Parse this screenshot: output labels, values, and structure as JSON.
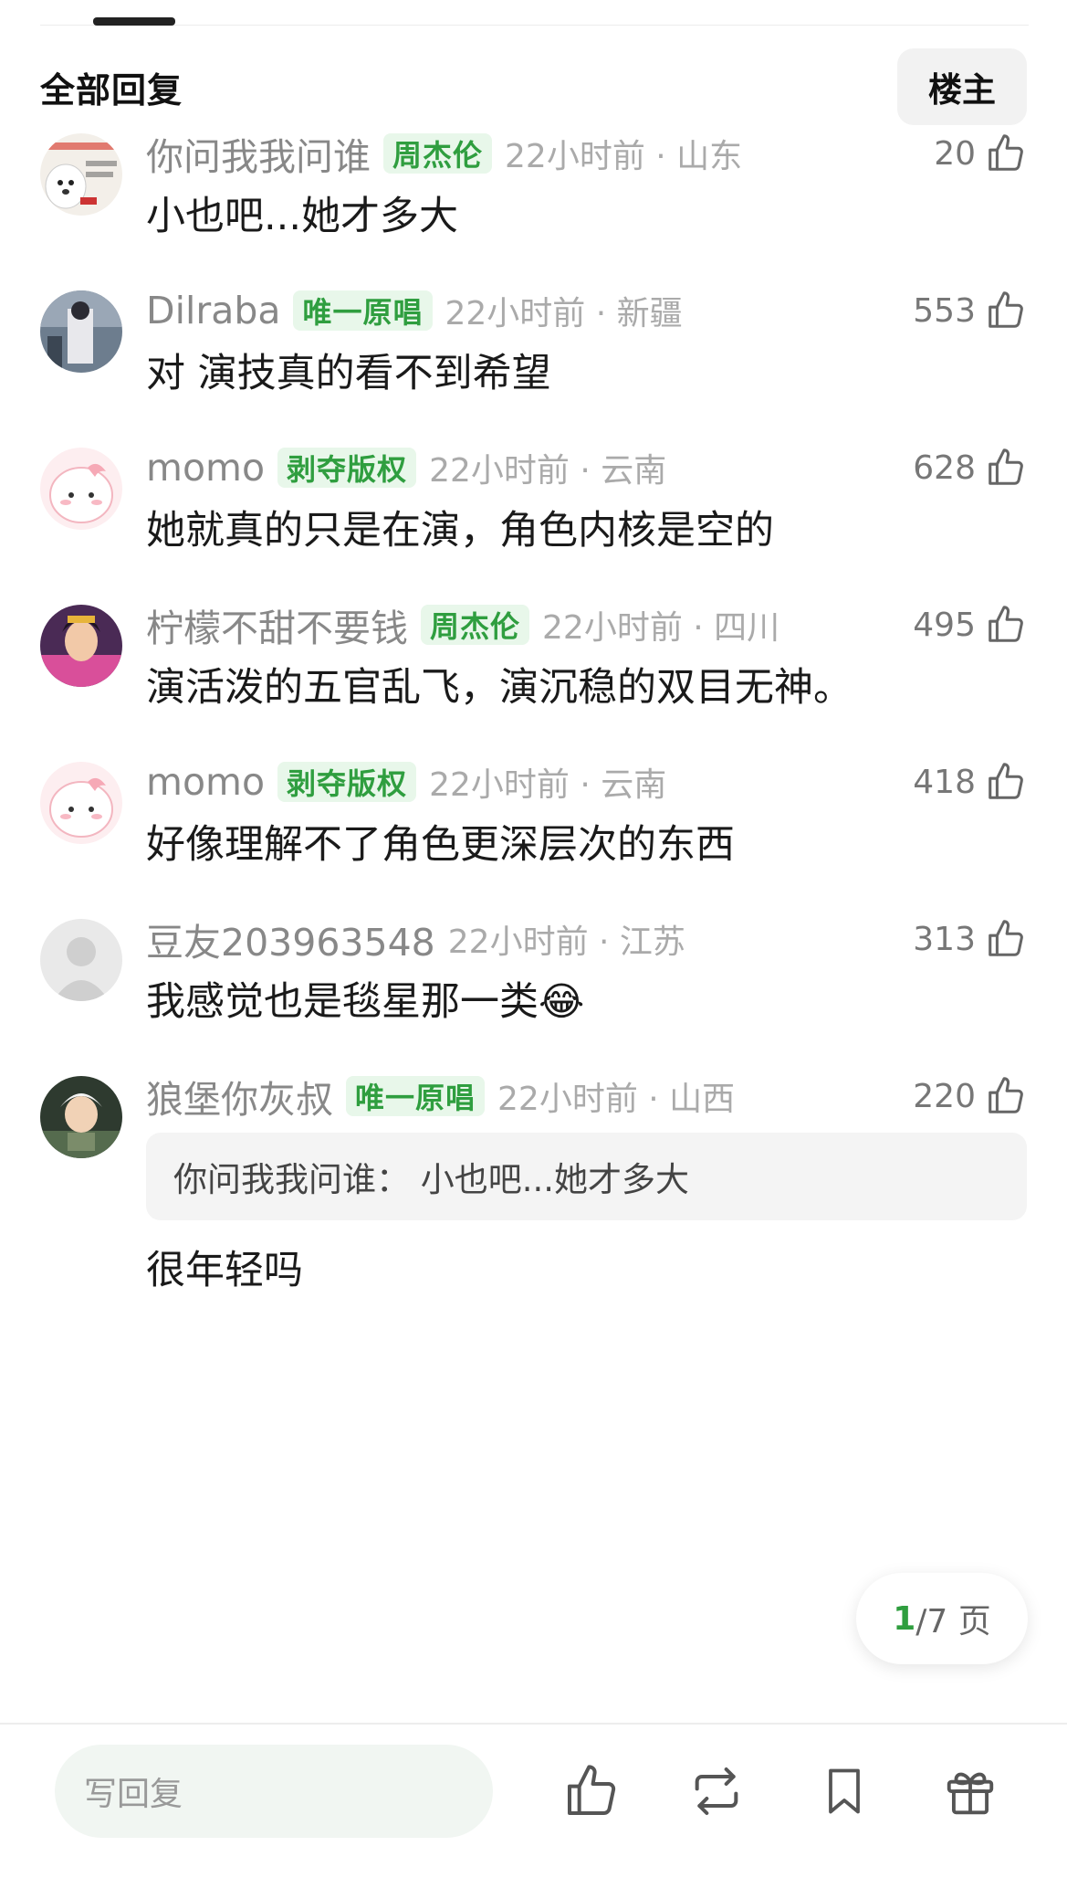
{
  "header": {
    "title": "全部回复",
    "owner_button": "楼主"
  },
  "comments": [
    {
      "user": "你问我我问谁",
      "badge": "周杰伦",
      "time": "22小时前 · 山东",
      "likes": "20",
      "text": "小也吧...她才多大"
    },
    {
      "user": "Dilraba",
      "badge": "唯一原唱",
      "time": "22小时前 · 新疆",
      "likes": "553",
      "text": "对 演技真的看不到希望"
    },
    {
      "user": "momo",
      "badge": "剥夺版权",
      "time": "22小时前 · 云南",
      "likes": "628",
      "text": "她就真的只是在演，角色内核是空的"
    },
    {
      "user": "柠檬不甜不要钱",
      "badge": "周杰伦",
      "time": "22小时前 · 四川",
      "likes": "495",
      "text": "演活泼的五官乱飞，演沉稳的双目无神。"
    },
    {
      "user": "momo",
      "badge": "剥夺版权",
      "time": "22小时前 · 云南",
      "likes": "418",
      "text": "好像理解不了角色更深层次的东西"
    },
    {
      "user": "豆友203963548",
      "badge": "",
      "time": "22小时前 · 江苏",
      "likes": "313",
      "text": "我感觉也是毯星那一类😂"
    },
    {
      "user": "狼堡你灰叔",
      "badge": "唯一原唱",
      "time": "22小时前 · 山西",
      "likes": "220",
      "quote": "你问我我问谁：  小也吧...她才多大",
      "text": "很年轻吗"
    }
  ],
  "pager": {
    "current": "1",
    "total_suffix": "/7 页"
  },
  "bottom_bar": {
    "reply_placeholder": "写回复"
  },
  "colors": {
    "badge_green": "#2f9e3f",
    "badge_bg": "#e8f7ea",
    "meta_gray": "#888888"
  }
}
